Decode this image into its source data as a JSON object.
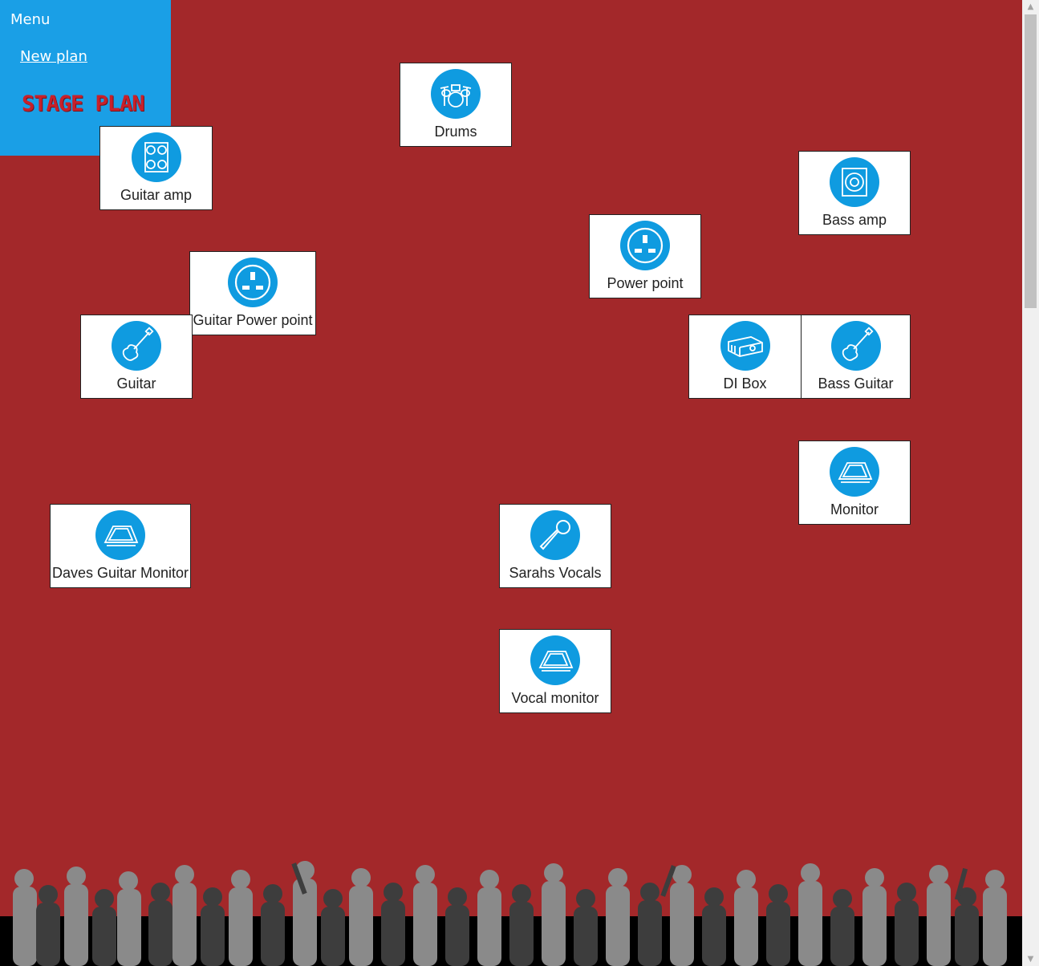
{
  "menu": {
    "title": "Menu",
    "new_plan_label": "New plan",
    "logo_text": "STAGE PLAN"
  },
  "items": {
    "drums": "Drums",
    "guitar_amp": "Guitar amp",
    "bass_amp": "Bass amp",
    "power_point": "Power point",
    "guitar_power_point": "Guitar Power point",
    "guitar": "Guitar",
    "di_box": "DI Box",
    "bass_guitar": "Bass Guitar",
    "monitor": "Monitor",
    "daves_guitar_monitor": "Daves Guitar Monitor",
    "sarahs_vocals": "Sarahs Vocals",
    "vocal_monitor": "Vocal monitor"
  },
  "colors": {
    "stage_background": "#a3282a",
    "menu_background": "#1a9fe6",
    "icon_circle": "#0f9be0",
    "item_background": "#ffffff"
  },
  "icons": {
    "drums": "drum-kit-icon",
    "guitar_amp": "guitar-amp-icon",
    "bass_amp": "bass-amp-icon",
    "power_point": "power-socket-icon",
    "guitar_power_point": "power-socket-icon",
    "guitar": "guitar-icon",
    "di_box": "di-box-icon",
    "bass_guitar": "guitar-icon",
    "monitor": "stage-monitor-icon",
    "daves_guitar_monitor": "stage-monitor-icon",
    "sarahs_vocals": "microphone-icon",
    "vocal_monitor": "stage-monitor-icon"
  }
}
